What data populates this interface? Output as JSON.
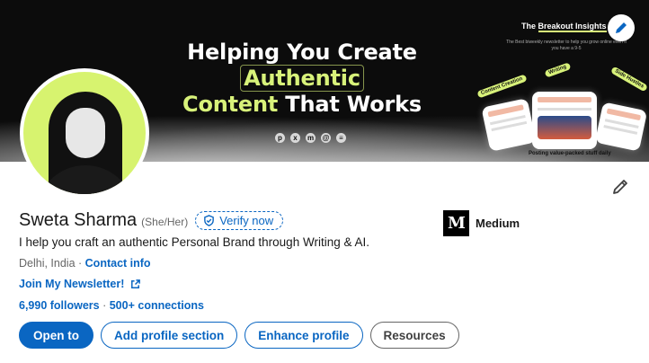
{
  "banner": {
    "headline_part1": "Helping You Create",
    "headline_highlight1": "Authentic",
    "headline_highlight2": "Content",
    "headline_part2": "That Works",
    "promo_title_prefix": "The",
    "promo_title_highlight": "Breakout Insights",
    "promo_subtitle": "The Best biweekly newsletter to help you grow online even if you have a 9-5",
    "tags": [
      "Content Creation",
      "Writing",
      "Side Hustles"
    ],
    "posting_text": "Posting value-packed stuff daily",
    "social_icons": [
      "pinterest-icon",
      "x-icon",
      "medium-icon",
      "threads-icon",
      "substack-icon"
    ]
  },
  "profile": {
    "name": "Sweta Sharma",
    "pronouns": "(She/Her)",
    "verify_label": "Verify now",
    "headline": "I help you craft an authentic Personal Brand through Writing & AI.",
    "location": "Delhi, India",
    "separator": " · ",
    "contact_info": "Contact info",
    "newsletter": "Join My Newsletter!",
    "followers": "6,990 followers",
    "connections": "500+ connections"
  },
  "company": {
    "logo_text": "M",
    "name": "Medium"
  },
  "actions": {
    "open_to": "Open to",
    "add_section": "Add profile section",
    "enhance": "Enhance profile",
    "resources": "Resources"
  },
  "colors": {
    "accent": "#0a66c2",
    "highlight": "#d8f27a"
  }
}
